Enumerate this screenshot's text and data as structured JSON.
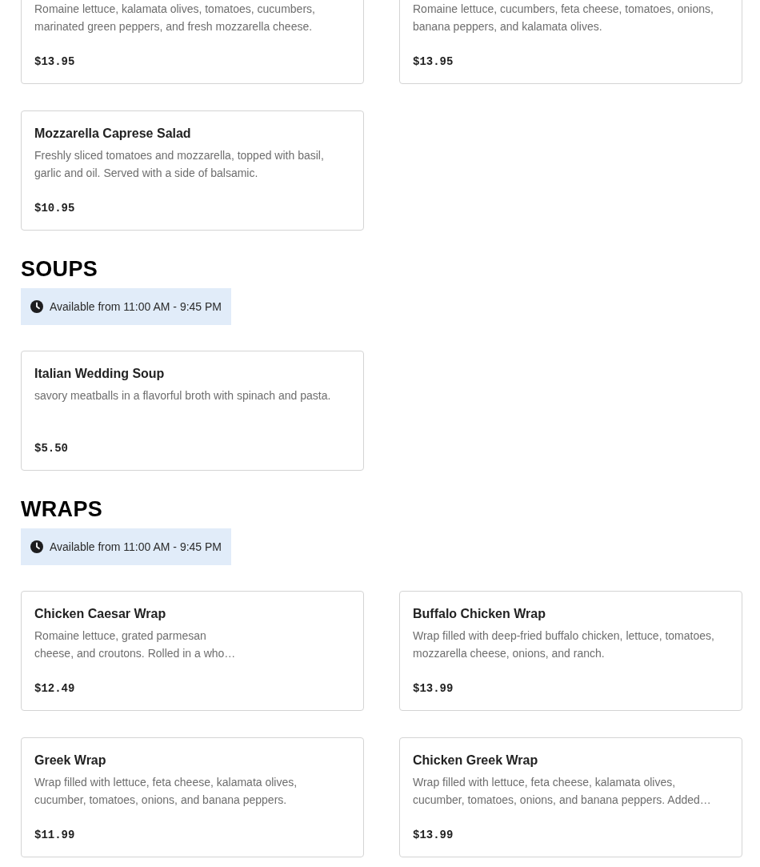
{
  "sections": [
    {
      "items": [
        {
          "description": "Romaine lettuce, kalamata olives, tomatoes, cucumbers,\nmarinated green peppers, and fresh mozzarella cheese.",
          "price": "$13.95"
        },
        {
          "description": "Romaine lettuce, cucumbers, feta cheese, tomatoes, onions,\nbanana peppers, and kalamata olives.",
          "price": "$13.95"
        },
        {
          "name": "Mozzarella Caprese Salad",
          "description": "Freshly sliced tomatoes and mozzarella, topped with basil,\ngarlic and oil. Served with a side of balsamic.",
          "price": "$10.95"
        }
      ]
    },
    {
      "heading": "SOUPS",
      "availability": "Available from 11:00 AM - 9:45 PM",
      "items": [
        {
          "name": "Italian Wedding Soup",
          "description": "savory meatballs in a flavorful broth with spinach and pasta.",
          "price": "$5.50"
        }
      ]
    },
    {
      "heading": "WRAPS",
      "availability": "Available from 11:00 AM - 9:45 PM",
      "items": [
        {
          "name": "Chicken Caesar Wrap",
          "description": "Romaine lettuce, grated parmesan\ncheese, and croutons. Rolled in a who…",
          "price": "$12.49"
        },
        {
          "name": "Buffalo Chicken Wrap",
          "description": "Wrap filled with deep-fried buffalo chicken, lettuce, tomatoes,\nmozzarella cheese, onions, and ranch.",
          "price": "$13.99"
        },
        {
          "name": "Greek Wrap",
          "description": "Wrap filled with lettuce, feta cheese, kalamata olives,\ncucumber, tomatoes, onions, and banana peppers.",
          "price": "$11.99"
        },
        {
          "name": "Chicken Greek Wrap",
          "description": "Wrap filled with lettuce, feta cheese, kalamata olives,\ncucumber, tomatoes, onions, and banana peppers. Added…",
          "price": "$13.99"
        }
      ]
    }
  ]
}
